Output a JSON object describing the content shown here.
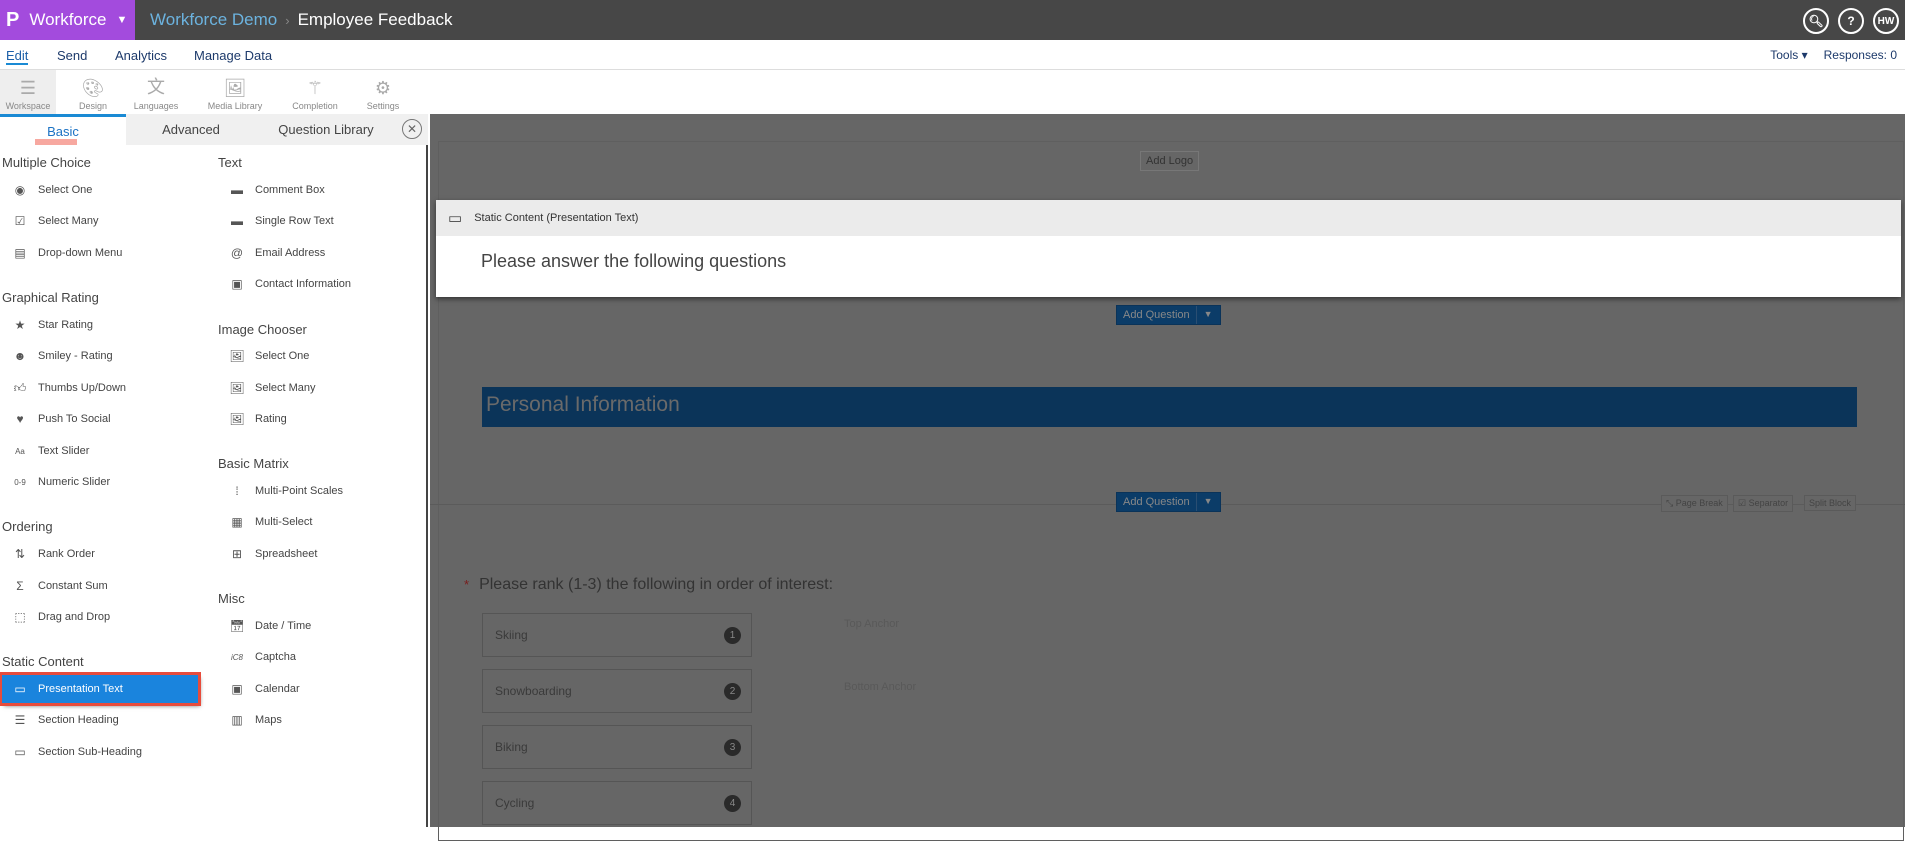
{
  "app": {
    "brand": "Workforce",
    "breadcrumb": [
      "Workforce Demo",
      "Employee Feedback"
    ],
    "user_initials": "HW"
  },
  "menu": {
    "items": [
      "Edit",
      "Send",
      "Analytics",
      "Manage Data"
    ],
    "active": "Edit",
    "tools_label": "Tools",
    "responses_label": "Responses: 0"
  },
  "toolbar": {
    "items": [
      "Workspace",
      "Design",
      "Languages",
      "Media Library",
      "Completion",
      "Settings"
    ],
    "active": "Workspace"
  },
  "panel": {
    "tabs": [
      "Basic",
      "Advanced",
      "Question Library"
    ],
    "active_tab": "Basic",
    "sections": {
      "multiple_choice": {
        "title": "Multiple Choice",
        "items": [
          "Select One",
          "Select Many",
          "Drop-down Menu"
        ]
      },
      "graphical_rating": {
        "title": "Graphical Rating",
        "items": [
          "Star Rating",
          "Smiley - Rating",
          "Thumbs Up/Down",
          "Push To Social",
          "Text Slider",
          "Numeric Slider"
        ]
      },
      "ordering": {
        "title": "Ordering",
        "items": [
          "Rank Order",
          "Constant Sum",
          "Drag and Drop"
        ]
      },
      "static_content": {
        "title": "Static Content",
        "items": [
          "Presentation Text",
          "Section Heading",
          "Section Sub-Heading"
        ],
        "selected": "Presentation Text"
      },
      "text": {
        "title": "Text",
        "items": [
          "Comment Box",
          "Single Row Text",
          "Email Address",
          "Contact Information"
        ]
      },
      "image_chooser": {
        "title": "Image Chooser",
        "items": [
          "Select One",
          "Select Many",
          "Rating"
        ]
      },
      "basic_matrix": {
        "title": "Basic Matrix",
        "items": [
          "Multi-Point Scales",
          "Multi-Select",
          "Spreadsheet"
        ]
      },
      "misc": {
        "title": "Misc",
        "items": [
          "Date / Time",
          "Captcha",
          "Calendar",
          "Maps"
        ]
      }
    }
  },
  "canvas": {
    "add_logo": "Add Logo",
    "static_content": {
      "header": "Static Content (Presentation Text)",
      "body": "Please answer the following questions"
    },
    "add_question": "Add Question",
    "section_heading": "Personal Information",
    "block_actions": [
      "Page Break",
      "Separator",
      "Split Block"
    ],
    "question": {
      "required_marker": "*",
      "text": "Please rank (1-3) the following in order of interest:",
      "options": [
        {
          "label": "Skiing",
          "rank": "1"
        },
        {
          "label": "Snowboarding",
          "rank": "2"
        },
        {
          "label": "Biking",
          "rank": "3"
        },
        {
          "label": "Cycling",
          "rank": "4"
        }
      ],
      "top_anchor": "Top Anchor",
      "bottom_anchor": "Bottom Anchor"
    }
  },
  "colors": {
    "brand": "#a34bdd",
    "topbar": "#474747",
    "selected": "#1a84dd",
    "highlight_outline": "#e74c3c",
    "section_heading_bg": "#0b3459"
  }
}
